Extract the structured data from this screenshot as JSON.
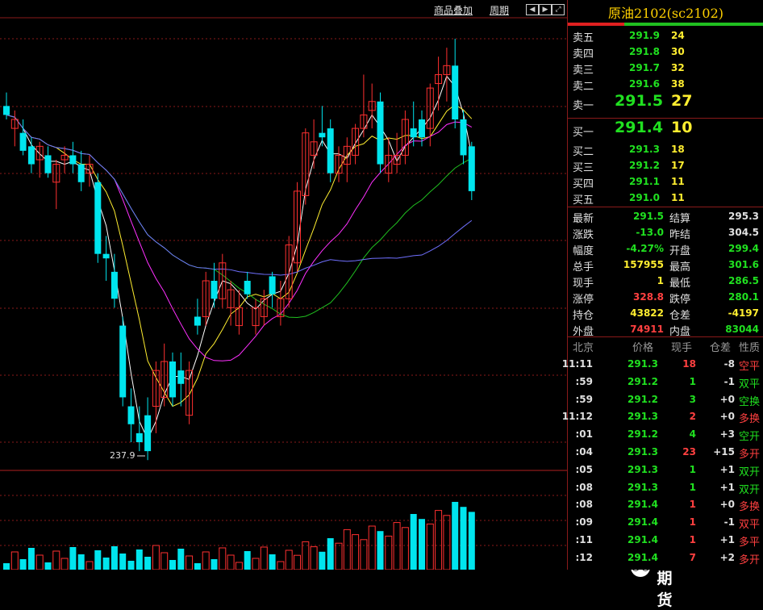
{
  "toolbar": {
    "overlay_label": "商品叠加",
    "period_label": "周期"
  },
  "chart": {
    "low_marker": "237.9",
    "candles": [
      {
        "o": 305,
        "h": 308,
        "l": 302,
        "c": 303,
        "dir": "down"
      },
      {
        "o": 300,
        "h": 304,
        "l": 296,
        "c": 302,
        "dir": "up"
      },
      {
        "o": 299,
        "h": 302,
        "l": 294,
        "c": 295,
        "dir": "down"
      },
      {
        "o": 296,
        "h": 298,
        "l": 290,
        "c": 292,
        "dir": "down"
      },
      {
        "o": 293,
        "h": 297,
        "l": 289,
        "c": 296,
        "dir": "up"
      },
      {
        "o": 294,
        "h": 296,
        "l": 289,
        "c": 290,
        "dir": "down"
      },
      {
        "o": 288,
        "h": 293,
        "l": 282,
        "c": 292,
        "dir": "up"
      },
      {
        "o": 293,
        "h": 296,
        "l": 290,
        "c": 294,
        "dir": "up"
      },
      {
        "o": 294,
        "h": 297,
        "l": 290,
        "c": 292,
        "dir": "down"
      },
      {
        "o": 292,
        "h": 295,
        "l": 286,
        "c": 288,
        "dir": "down"
      },
      {
        "o": 290,
        "h": 294,
        "l": 287,
        "c": 292,
        "dir": "up"
      },
      {
        "o": 288,
        "h": 290,
        "l": 270,
        "c": 272,
        "dir": "down"
      },
      {
        "o": 272,
        "h": 276,
        "l": 266,
        "c": 271,
        "dir": "down"
      },
      {
        "o": 268,
        "h": 272,
        "l": 260,
        "c": 262,
        "dir": "down"
      },
      {
        "o": 256,
        "h": 258,
        "l": 238,
        "c": 240,
        "dir": "down"
      },
      {
        "o": 238,
        "h": 242,
        "l": 230,
        "c": 234,
        "dir": "down"
      },
      {
        "o": 232,
        "h": 238,
        "l": 228,
        "c": 230,
        "dir": "down"
      },
      {
        "o": 236,
        "h": 240,
        "l": 226,
        "c": 228,
        "dir": "down"
      },
      {
        "o": 238,
        "h": 248,
        "l": 232,
        "c": 246,
        "dir": "up"
      },
      {
        "o": 240,
        "h": 252,
        "l": 238,
        "c": 248,
        "dir": "up"
      },
      {
        "o": 248,
        "h": 250,
        "l": 238,
        "c": 240,
        "dir": "down"
      },
      {
        "o": 243,
        "h": 250,
        "l": 238,
        "c": 246,
        "dir": "down"
      },
      {
        "o": 236,
        "h": 248,
        "l": 234,
        "c": 246,
        "dir": "up"
      },
      {
        "o": 258,
        "h": 262,
        "l": 254,
        "c": 256,
        "dir": "down"
      },
      {
        "o": 258,
        "h": 268,
        "l": 256,
        "c": 266,
        "dir": "up"
      },
      {
        "o": 266,
        "h": 270,
        "l": 260,
        "c": 262,
        "dir": "down"
      },
      {
        "o": 262,
        "h": 272,
        "l": 260,
        "c": 270,
        "dir": "up"
      },
      {
        "o": 260,
        "h": 266,
        "l": 256,
        "c": 264,
        "dir": "up"
      },
      {
        "o": 260,
        "h": 264,
        "l": 254,
        "c": 256,
        "dir": "up"
      },
      {
        "o": 266,
        "h": 268,
        "l": 262,
        "c": 263,
        "dir": "down"
      },
      {
        "o": 256,
        "h": 262,
        "l": 254,
        "c": 260,
        "dir": "up"
      },
      {
        "o": 258,
        "h": 264,
        "l": 256,
        "c": 262,
        "dir": "up"
      },
      {
        "o": 263,
        "h": 268,
        "l": 260,
        "c": 267,
        "dir": "down"
      },
      {
        "o": 258,
        "h": 266,
        "l": 256,
        "c": 262,
        "dir": "up"
      },
      {
        "o": 262,
        "h": 276,
        "l": 260,
        "c": 274,
        "dir": "up"
      },
      {
        "o": 270,
        "h": 288,
        "l": 268,
        "c": 286,
        "dir": "up"
      },
      {
        "o": 285,
        "h": 300,
        "l": 283,
        "c": 299,
        "dir": "up"
      },
      {
        "o": 297,
        "h": 302,
        "l": 291,
        "c": 294,
        "dir": "up"
      },
      {
        "o": 298,
        "h": 305,
        "l": 296,
        "c": 299,
        "dir": "down"
      },
      {
        "o": 300,
        "h": 302,
        "l": 288,
        "c": 290,
        "dir": "down"
      },
      {
        "o": 290,
        "h": 296,
        "l": 288,
        "c": 294,
        "dir": "up"
      },
      {
        "o": 292,
        "h": 298,
        "l": 288,
        "c": 296,
        "dir": "up"
      },
      {
        "o": 294,
        "h": 301,
        "l": 292,
        "c": 300,
        "dir": "up"
      },
      {
        "o": 300,
        "h": 312,
        "l": 298,
        "c": 303,
        "dir": "up"
      },
      {
        "o": 304,
        "h": 310,
        "l": 300,
        "c": 306,
        "dir": "up"
      },
      {
        "o": 306,
        "h": 308,
        "l": 290,
        "c": 292,
        "dir": "down"
      },
      {
        "o": 290,
        "h": 298,
        "l": 288,
        "c": 294,
        "dir": "up"
      },
      {
        "o": 294,
        "h": 299,
        "l": 290,
        "c": 292,
        "dir": "up"
      },
      {
        "o": 294,
        "h": 304,
        "l": 292,
        "c": 302,
        "dir": "up"
      },
      {
        "o": 298,
        "h": 306,
        "l": 296,
        "c": 300,
        "dir": "down"
      },
      {
        "o": 302,
        "h": 304,
        "l": 296,
        "c": 298,
        "dir": "down"
      },
      {
        "o": 300,
        "h": 310,
        "l": 296,
        "c": 309,
        "dir": "up"
      },
      {
        "o": 310,
        "h": 316,
        "l": 304,
        "c": 312,
        "dir": "up"
      },
      {
        "o": 312,
        "h": 318,
        "l": 306,
        "c": 314,
        "dir": "up"
      },
      {
        "o": 314,
        "h": 320,
        "l": 300,
        "c": 302,
        "dir": "down"
      },
      {
        "o": 302,
        "h": 304,
        "l": 292,
        "c": 294,
        "dir": "down"
      },
      {
        "o": 296,
        "h": 297,
        "l": 284,
        "c": 286,
        "dir": "down"
      }
    ]
  },
  "panel": {
    "title": "原油2102(sc2102)",
    "asks": [
      {
        "label": "卖五",
        "price": "291.9",
        "vol": "24"
      },
      {
        "label": "卖四",
        "price": "291.8",
        "vol": "30"
      },
      {
        "label": "卖三",
        "price": "291.7",
        "vol": "32"
      },
      {
        "label": "卖二",
        "price": "291.6",
        "vol": "38"
      },
      {
        "label": "卖一",
        "price": "291.5",
        "vol": "27"
      }
    ],
    "bids": [
      {
        "label": "买一",
        "price": "291.4",
        "vol": "10"
      },
      {
        "label": "买二",
        "price": "291.3",
        "vol": "18"
      },
      {
        "label": "买三",
        "price": "291.2",
        "vol": "17"
      },
      {
        "label": "买四",
        "price": "291.1",
        "vol": "11"
      },
      {
        "label": "买五",
        "price": "291.0",
        "vol": "11"
      }
    ],
    "stats": [
      {
        "l1": "最新",
        "v1": "291.5",
        "c1": "g",
        "l2": "结算",
        "v2": "295.3",
        "c2": "w"
      },
      {
        "l1": "涨跌",
        "v1": "-13.0",
        "c1": "g",
        "l2": "昨结",
        "v2": "304.5",
        "c2": "w"
      },
      {
        "l1": "幅度",
        "v1": "-4.27%",
        "c1": "g",
        "l2": "开盘",
        "v2": "299.4",
        "c2": "g"
      },
      {
        "l1": "总手",
        "v1": "157955",
        "c1": "y",
        "l2": "最高",
        "v2": "301.6",
        "c2": "g"
      },
      {
        "l1": "现手",
        "v1": "1",
        "c1": "y",
        "l2": "最低",
        "v2": "286.5",
        "c2": "g"
      },
      {
        "l1": "涨停",
        "v1": "328.8",
        "c1": "r",
        "l2": "跌停",
        "v2": "280.1",
        "c2": "g"
      },
      {
        "l1": "持仓",
        "v1": "43822",
        "c1": "y",
        "l2": "仓差",
        "v2": "-4197",
        "c2": "y"
      },
      {
        "l1": "外盘",
        "v1": "74911",
        "c1": "r",
        "l2": "内盘",
        "v2": "83044",
        "c2": "g"
      }
    ],
    "tick_headers": [
      "北京",
      "价格",
      "现手",
      "仓差",
      "性质"
    ],
    "ticks": [
      {
        "time": "11:11",
        "price": "291.3",
        "vol": "18",
        "vc": "r",
        "diff": "-8",
        "nature": "空平",
        "nc": "r"
      },
      {
        "time": ":59",
        "price": "291.2",
        "vol": "1",
        "vc": "g",
        "diff": "-1",
        "nature": "双平",
        "nc": "g"
      },
      {
        "time": ":59",
        "price": "291.2",
        "vol": "3",
        "vc": "g",
        "diff": "+0",
        "nature": "空换",
        "nc": "g"
      },
      {
        "time": "11:12",
        "price": "291.3",
        "vol": "2",
        "vc": "r",
        "diff": "+0",
        "nature": "多换",
        "nc": "r"
      },
      {
        "time": ":01",
        "price": "291.2",
        "vol": "4",
        "vc": "g",
        "diff": "+3",
        "nature": "空开",
        "nc": "g"
      },
      {
        "time": ":04",
        "price": "291.3",
        "vol": "23",
        "vc": "r",
        "diff": "+15",
        "nature": "多开",
        "nc": "r"
      },
      {
        "time": ":05",
        "price": "291.3",
        "vol": "1",
        "vc": "g",
        "diff": "+1",
        "nature": "双开",
        "nc": "g"
      },
      {
        "time": ":08",
        "price": "291.3",
        "vol": "1",
        "vc": "g",
        "diff": "+1",
        "nature": "双开",
        "nc": "g"
      },
      {
        "time": ":08",
        "price": "291.4",
        "vol": "1",
        "vc": "r",
        "diff": "+0",
        "nature": "多换",
        "nc": "r"
      },
      {
        "time": ":09",
        "price": "291.4",
        "vol": "1",
        "vc": "r",
        "diff": "-1",
        "nature": "双平",
        "nc": "r"
      },
      {
        "time": ":11",
        "price": "291.4",
        "vol": "1",
        "vc": "r",
        "diff": "+1",
        "nature": "多平",
        "nc": "r"
      },
      {
        "time": ":12",
        "price": "291.4",
        "vol": "7",
        "vc": "r",
        "diff": "+2",
        "nature": "多开",
        "nc": "r"
      }
    ]
  },
  "watermark": "星空期货"
}
